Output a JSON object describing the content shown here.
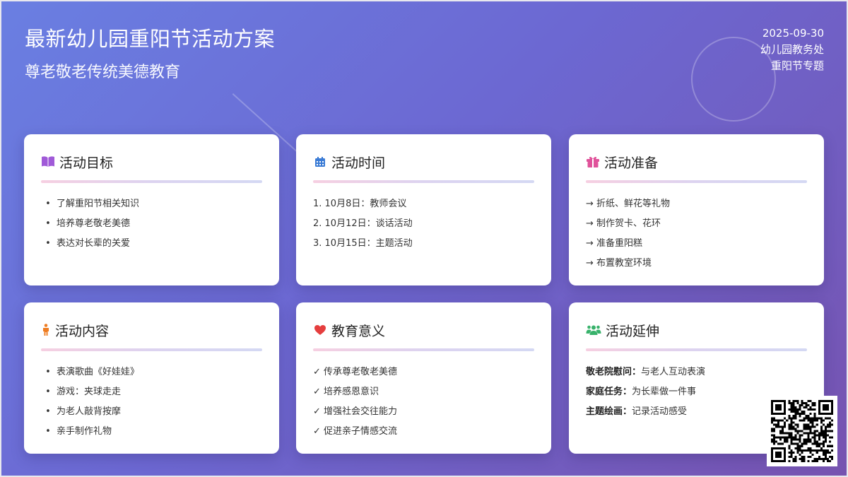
{
  "header": {
    "title": "最新幼儿园重阳节活动方案",
    "subtitle": "尊老敬老传统美德教育",
    "date": "2025-09-30",
    "office": "幼儿园教务处",
    "topic": "重阳节专题"
  },
  "cards": {
    "goals": {
      "icon": "book-icon",
      "title": "活动目标",
      "items": [
        "了解重阳节相关知识",
        "培养尊老敬老美德",
        "表达对长辈的关爱"
      ]
    },
    "time": {
      "icon": "calendar-icon",
      "title": "活动时间",
      "items": [
        "1. 10月8日：教师会议",
        "2. 10月12日：谈话活动",
        "3. 10月15日：主题活动"
      ]
    },
    "prep": {
      "icon": "gift-icon",
      "title": "活动准备",
      "items": [
        "→ 折纸、鲜花等礼物",
        "→ 制作贺卡、花环",
        "→ 准备重阳糕",
        "→ 布置教室环境"
      ]
    },
    "content": {
      "icon": "child-icon",
      "title": "活动内容",
      "items": [
        "表演歌曲《好娃娃》",
        "游戏：夹球走走",
        "为老人敲背按摩",
        "亲手制作礼物"
      ]
    },
    "meaning": {
      "icon": "heart-icon",
      "title": "教育意义",
      "items": [
        "✓ 传承尊老敬老美德",
        "✓ 培养感恩意识",
        "✓ 增强社会交往能力",
        "✓ 促进亲子情感交流"
      ]
    },
    "extend": {
      "icon": "users-icon",
      "title": "活动延伸",
      "items": [
        {
          "key": "敬老院慰问：",
          "value": "与老人互动表演"
        },
        {
          "key": "家庭任务：",
          "value": "为长辈做一件事"
        },
        {
          "key": "主题绘画：",
          "value": "记录活动感受"
        }
      ]
    }
  },
  "colors": {
    "book": "#a05ad8",
    "calendar": "#3a7bd5",
    "gift": "#e0529a",
    "child": "#ef7d22",
    "heart": "#e53e3e",
    "users": "#38b26b"
  },
  "qr": {
    "icon": "qr-code-icon"
  }
}
